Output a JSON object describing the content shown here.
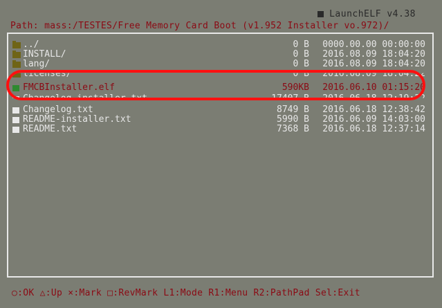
{
  "header": {
    "title": "LaunchELF v4.38"
  },
  "path": {
    "label": "Path:",
    "value": "mass:/TESTES/Free Memory Card Boot (v1.952 Installer vo.972)/"
  },
  "files": [
    {
      "icon": "folder-icon",
      "name": "../",
      "size": "0 B",
      "date": "0000.00.00 00:00:00",
      "selected": false
    },
    {
      "icon": "folder-icon",
      "name": "INSTALL/",
      "size": "0 B",
      "date": "2016.08.09 18:04:20",
      "selected": false
    },
    {
      "icon": "folder-icon",
      "name": "lang/",
      "size": "0 B",
      "date": "2016.08.09 18:04:20",
      "selected": false
    },
    {
      "icon": "folder-icon",
      "name": "licenses/",
      "size": "0 B",
      "date": "2016.08.09 18:04:22",
      "selected": false
    },
    {
      "icon": "elf-file-icon",
      "name": "FMCBInstaller.elf",
      "size": "590KB",
      "date": "2016.06.10 01:15:20",
      "selected": true
    },
    {
      "icon": "file-icon",
      "name": "Changelog-installer.txt",
      "size": "17407 B",
      "date": "2016.06.18 12:19:22",
      "selected": false
    },
    {
      "icon": "file-icon",
      "name": "Changelog.txt",
      "size": "8749 B",
      "date": "2016.06.18 12:38:42",
      "selected": false
    },
    {
      "icon": "file-icon",
      "name": "README-installer.txt",
      "size": "5990 B",
      "date": "2016.06.09 14:03:00",
      "selected": false
    },
    {
      "icon": "file-icon",
      "name": "README.txt",
      "size": "7368 B",
      "date": "2016.06.18 12:37:14",
      "selected": false
    }
  ],
  "footer": {
    "help": "○:OK △:Up ×:Mark □:RevMark L1:Mode R1:Menu R2:PathPad Sel:Exit"
  }
}
